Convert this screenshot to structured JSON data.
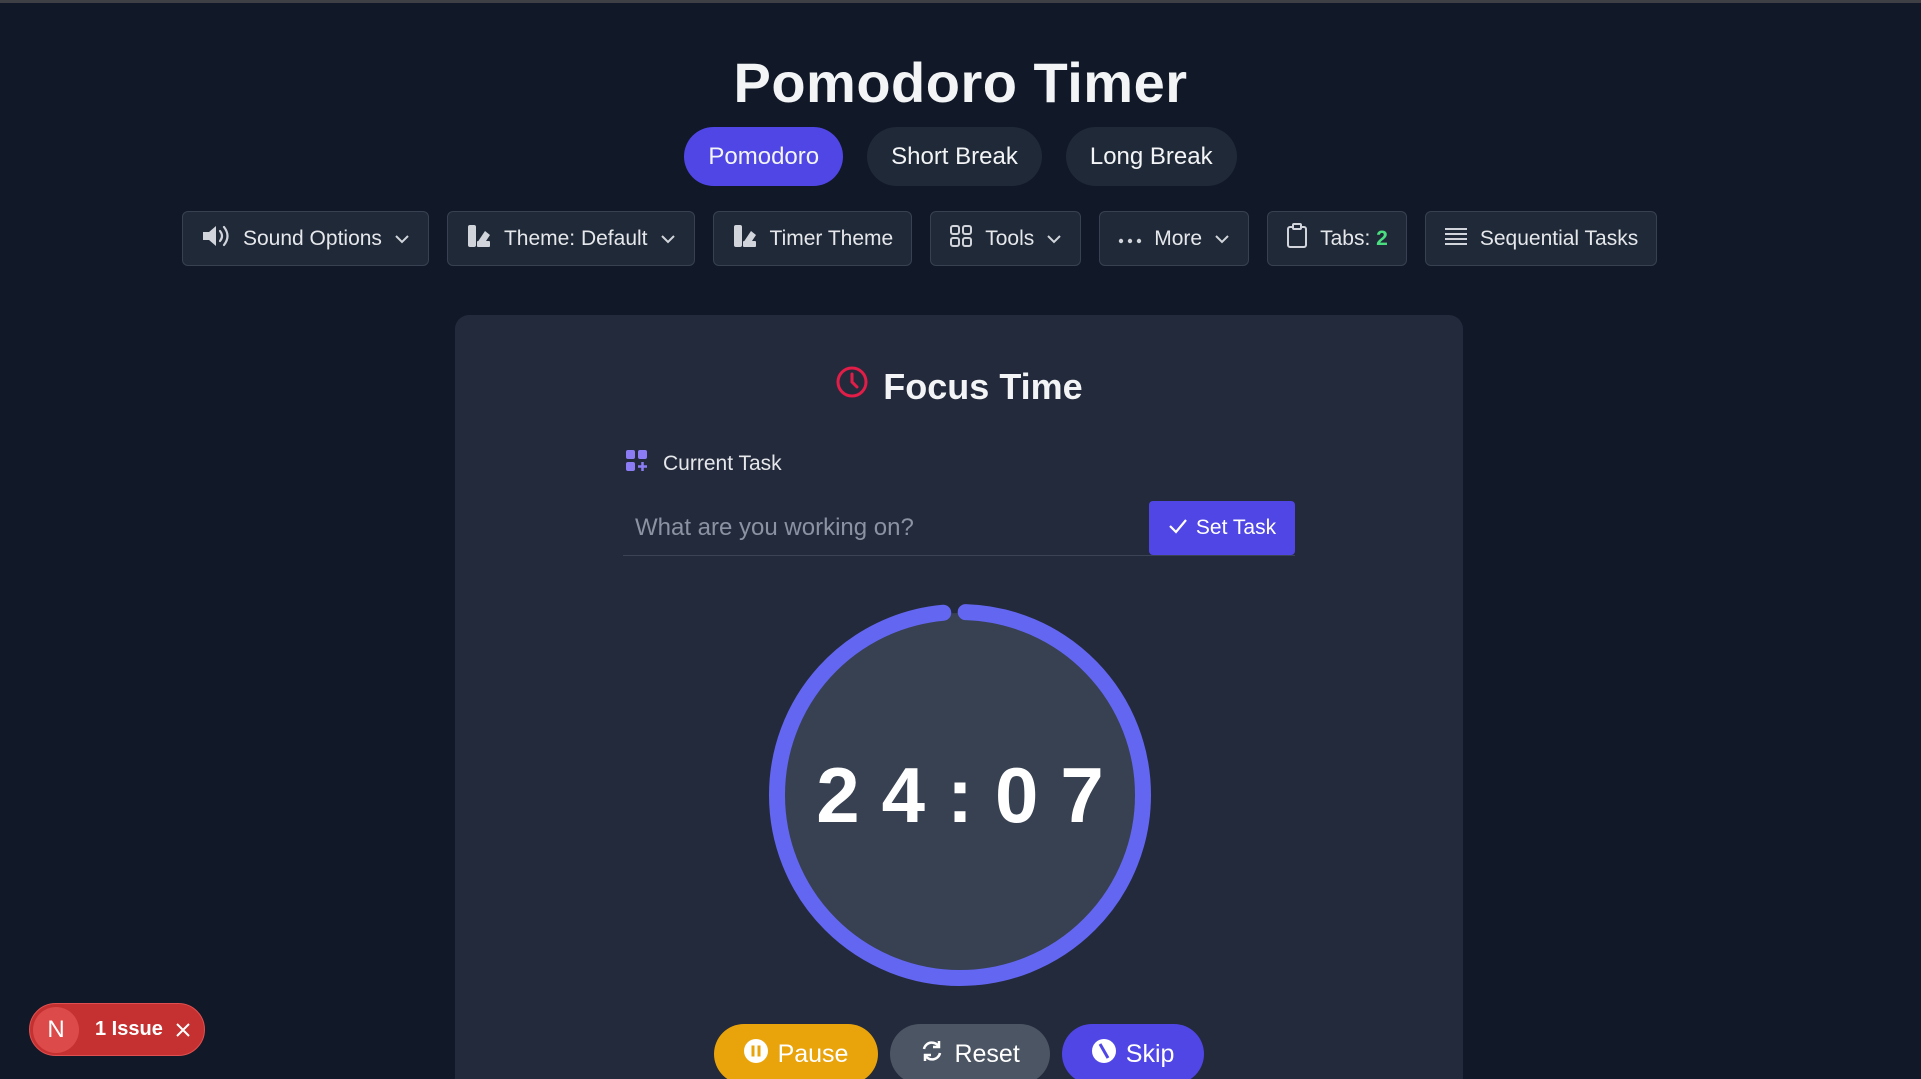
{
  "app": {
    "title": "Pomodoro Timer"
  },
  "mode_tabs": [
    {
      "label": "Pomodoro",
      "active": true
    },
    {
      "label": "Short Break",
      "active": false
    },
    {
      "label": "Long Break",
      "active": false
    }
  ],
  "toolbar": {
    "sound_options": "Sound Options",
    "theme": "Theme: Default",
    "timer_theme": "Timer Theme",
    "tools": "Tools",
    "more": "More",
    "tabs_label": "Tabs:",
    "tabs_count": "2",
    "sequential_tasks": "Sequential Tasks"
  },
  "card": {
    "title": "Focus Time",
    "task_label": "Current Task",
    "task_placeholder": "What are you working on?",
    "set_task_label": "Set Task",
    "timer": "24:07",
    "progress_fraction": 0.98
  },
  "controls": {
    "pause": "Pause",
    "reset": "Reset",
    "skip": "Skip"
  },
  "issues": {
    "letter": "N",
    "label": "1 Issue"
  },
  "colors": {
    "background": "#111827",
    "accent": "#4f46e5",
    "ring": "#6366f1",
    "pause": "#e9a30b",
    "focus_icon": "#e11d48",
    "issue": "#c53030"
  }
}
